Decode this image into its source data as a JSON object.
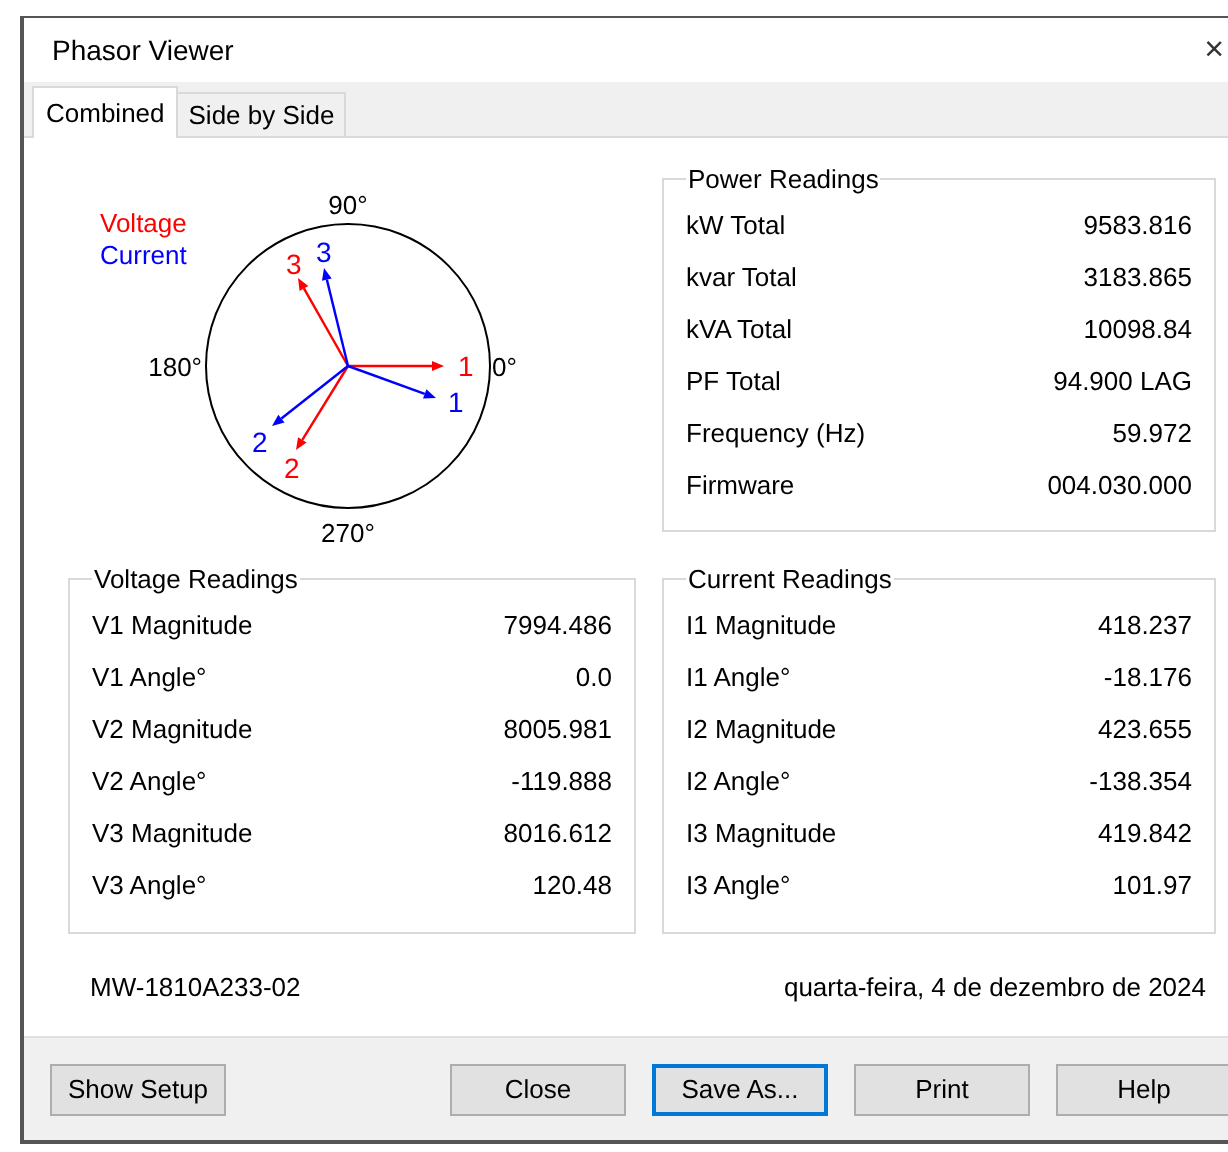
{
  "window": {
    "title": "Phasor Viewer",
    "close": "×"
  },
  "tabs": [
    {
      "label": "Combined",
      "selected": true
    },
    {
      "label": "Side by Side",
      "selected": false
    }
  ],
  "phasor": {
    "legend": [
      {
        "label": "Voltage",
        "color": "#ff0000"
      },
      {
        "label": "Current",
        "color": "#0000ff"
      }
    ],
    "angle_labels": [
      "90°",
      "0°",
      "180°",
      "270°"
    ],
    "phasors": [
      {
        "label": "1",
        "color": "#ff0000"
      },
      {
        "label": "2",
        "color": "#ff0000"
      },
      {
        "label": "3",
        "color": "#ff0000"
      },
      {
        "label": "1",
        "color": "#0000ff"
      },
      {
        "label": "2",
        "color": "#0000ff"
      },
      {
        "label": "3",
        "color": "#0000ff"
      }
    ]
  },
  "power_readings": {
    "title": "Power Readings",
    "rows": [
      {
        "label": "kW Total",
        "value": "9583.816"
      },
      {
        "label": "kvar Total",
        "value": "3183.865"
      },
      {
        "label": "kVA Total",
        "value": "10098.84"
      },
      {
        "label": "PF Total",
        "value": "94.900 LAG"
      },
      {
        "label": "Frequency (Hz)",
        "value": "59.972"
      },
      {
        "label": "Firmware",
        "value": "004.030.000"
      }
    ]
  },
  "voltage_readings": {
    "title": "Voltage Readings",
    "rows": [
      {
        "label": "V1 Magnitude",
        "value": "7994.486"
      },
      {
        "label": "V1 Angle°",
        "value": "0.0"
      },
      {
        "label": "V2 Magnitude",
        "value": "8005.981"
      },
      {
        "label": "V2 Angle°",
        "value": "-119.888"
      },
      {
        "label": "V3 Magnitude",
        "value": "8016.612"
      },
      {
        "label": "V3 Angle°",
        "value": "120.48"
      }
    ]
  },
  "current_readings": {
    "title": "Current Readings",
    "rows": [
      {
        "label": "I1 Magnitude",
        "value": "418.237"
      },
      {
        "label": "I1 Angle°",
        "value": "-18.176"
      },
      {
        "label": "I2 Magnitude",
        "value": "423.655"
      },
      {
        "label": "I2 Angle°",
        "value": "-138.354"
      },
      {
        "label": "I3 Magnitude",
        "value": "419.842"
      },
      {
        "label": "I3 Angle°",
        "value": "101.97"
      }
    ]
  },
  "footer": {
    "serial": "MW-1810A233-02",
    "date": "quarta-feira, 4 de dezembro de 2024"
  },
  "buttons": [
    {
      "label": "Show Setup",
      "focused": false
    },
    {
      "label": "Close",
      "focused": false
    },
    {
      "label": "Save As...",
      "focused": true
    },
    {
      "label": "Print",
      "focused": false
    },
    {
      "label": "Help",
      "focused": false
    }
  ]
}
